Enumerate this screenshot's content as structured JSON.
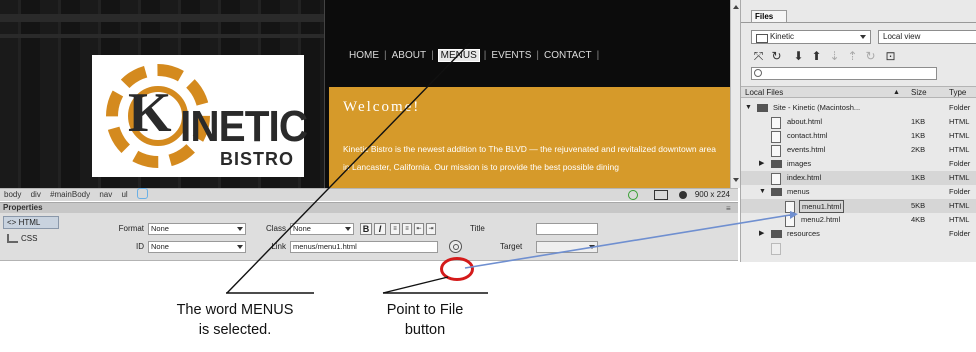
{
  "page": {
    "nav_items": [
      "HOME",
      "ABOUT",
      "MENUS",
      "EVENTS",
      "CONTACT"
    ],
    "logo": {
      "k_letter": "K",
      "word": "INETIC",
      "sub": "BISTRO"
    },
    "welcome": {
      "title": "Welcome!",
      "text": "Kinetic Bistro is the newest addition to The BLVD — the rejuvenated and revitalized downtown area in Lancaster, California. Our mission is to provide the best possible dining"
    }
  },
  "status_bar": {
    "crumbs": [
      "body",
      "div",
      "#mainBody",
      "nav",
      "ul"
    ],
    "size": "900 x 224"
  },
  "properties": {
    "title": "Properties",
    "html_mode": "<> HTML",
    "css_mode": "CSS",
    "format_label": "Format",
    "format_value": "None",
    "id_label": "ID",
    "id_value": "None",
    "class_label": "Class",
    "class_value": "None",
    "link_label": "Link",
    "link_value": "menus/menu1.html",
    "title_label": "Title",
    "target_label": "Target",
    "bold": "B",
    "italic": "I"
  },
  "files_panel": {
    "tab": "Files",
    "site": "Kinetic",
    "view": "Local view",
    "columns": {
      "name": "Local Files",
      "size": "Size",
      "type": "Type"
    },
    "rows": [
      {
        "name": "Site - Kinetic (Macintosh...",
        "size": "",
        "type": "Folder"
      },
      {
        "name": "about.html",
        "size": "1KB",
        "type": "HTML"
      },
      {
        "name": "contact.html",
        "size": "1KB",
        "type": "HTML"
      },
      {
        "name": "events.html",
        "size": "2KB",
        "type": "HTML"
      },
      {
        "name": "images",
        "size": "",
        "type": "Folder"
      },
      {
        "name": "index.html",
        "size": "1KB",
        "type": "HTML"
      },
      {
        "name": "menus",
        "size": "",
        "type": "Folder"
      },
      {
        "name": "menu1.html",
        "size": "5KB",
        "type": "HTML"
      },
      {
        "name": "menu2.html",
        "size": "4KB",
        "type": "HTML"
      },
      {
        "name": "resources",
        "size": "",
        "type": "Folder"
      }
    ]
  },
  "callouts": {
    "menus": [
      "The word MENUS",
      "is selected."
    ],
    "point": [
      "Point to File",
      "button"
    ]
  },
  "colors": {
    "accent_orange": "#d69a2a",
    "pointer_blue": "#6f8fd0",
    "highlight_red": "#d41a1a"
  }
}
